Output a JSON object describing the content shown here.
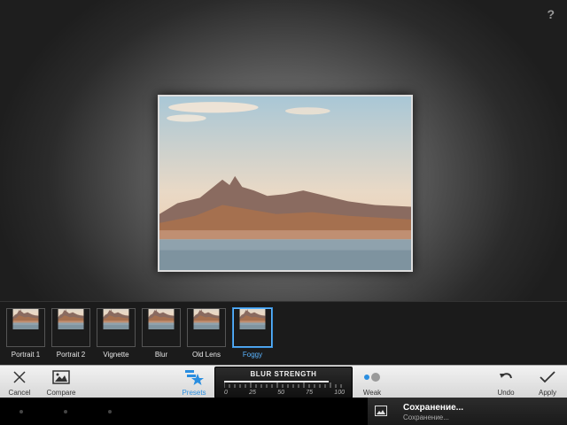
{
  "help": {
    "label": "?"
  },
  "presets": [
    {
      "label": "Portrait 1",
      "selected": false
    },
    {
      "label": "Portrait 2",
      "selected": false
    },
    {
      "label": "Vignette",
      "selected": false
    },
    {
      "label": "Blur",
      "selected": false
    },
    {
      "label": "Old Lens",
      "selected": false
    },
    {
      "label": "Foggy",
      "selected": true
    }
  ],
  "toolbar": {
    "cancel_label": "Cancel",
    "compare_label": "Compare",
    "presets_label": "Presets",
    "strength_title": "BLUR STRENGTH",
    "strength_ticks": [
      "0",
      "25",
      "50",
      "75",
      "100"
    ],
    "weak_label": "Weak",
    "undo_label": "Undo",
    "apply_label": "Apply"
  },
  "notification": {
    "title": "Сохранение...",
    "subtitle": "Сохранение..."
  },
  "colors": {
    "accent": "#2a8ee0",
    "selected_border": "#5ab4ff"
  }
}
